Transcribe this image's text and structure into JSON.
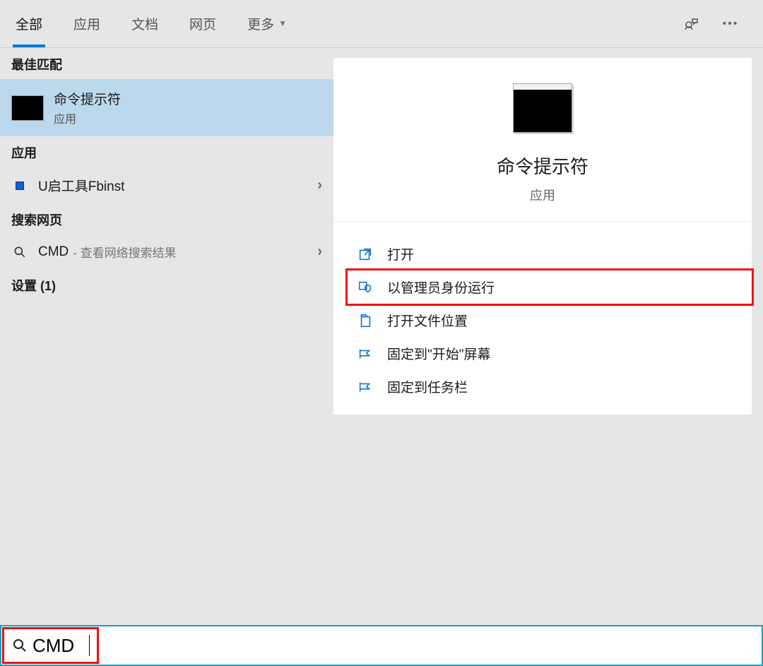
{
  "tabs": {
    "all": "全部",
    "apps": "应用",
    "docs": "文档",
    "web": "网页",
    "more": "更多"
  },
  "left": {
    "best_match_heading": "最佳匹配",
    "best_match": {
      "title": "命令提示符",
      "subtitle": "应用"
    },
    "apps_heading": "应用",
    "app_item": "U启工具Fbinst",
    "web_heading": "搜索网页",
    "web_item": {
      "term": "CMD",
      "hint": "- 查看网络搜索结果"
    },
    "settings_heading": "设置 (1)"
  },
  "detail": {
    "title": "命令提示符",
    "subtitle": "应用",
    "actions": {
      "open": "打开",
      "run_admin": "以管理员身份运行",
      "open_loc": "打开文件位置",
      "pin_start": "固定到\"开始\"屏幕",
      "pin_taskbar": "固定到任务栏"
    }
  },
  "search": {
    "query": "CMD"
  }
}
